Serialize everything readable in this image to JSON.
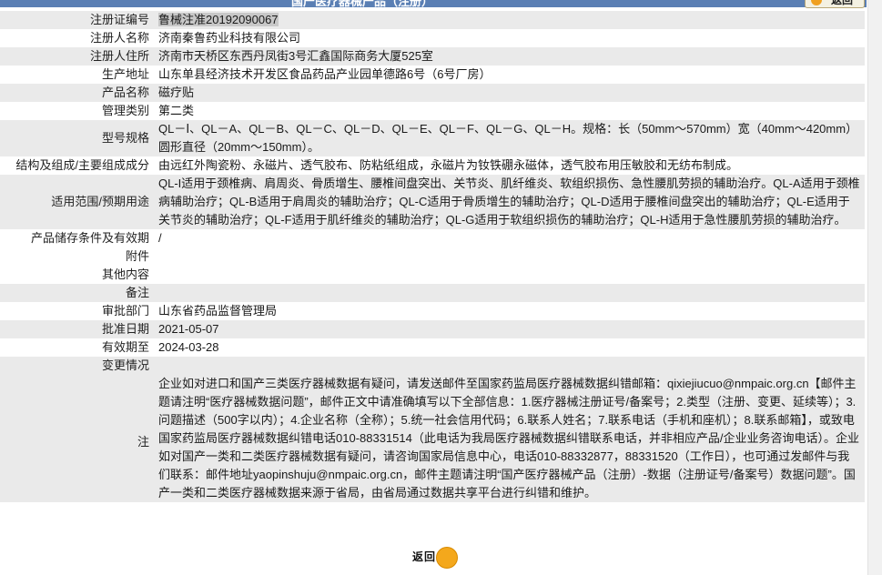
{
  "page": {
    "title": "国产医疗器械产品（注册）",
    "back_label": "返回"
  },
  "fields": [
    {
      "label": "注册证编号",
      "value": "鲁械注准20192090067"
    },
    {
      "label": "注册人名称",
      "value": "济南秦鲁药业科技有限公司"
    },
    {
      "label": "注册人住所",
      "value": "济南市天桥区东西丹凤街3号汇鑫国际商务大厦525室"
    },
    {
      "label": "生产地址",
      "value": "山东单县经济技术开发区食品药品产业园单德路6号（6号厂房）"
    },
    {
      "label": "产品名称",
      "value": "磁疗贴"
    },
    {
      "label": "管理类别",
      "value": "第二类"
    },
    {
      "label": "型号规格",
      "value": "QL－Ⅰ、QL－A、QL－B、QL－C、QL－D、QL－E、QL－F、QL－G、QL－H。规格：长（50mm～570mm）宽（40mm～420mm）圆形直径（20mm～150mm）。"
    },
    {
      "label": "结构及组成/主要组成成分",
      "value": "由远红外陶瓷粉、永磁片、透气胶布、防粘纸组成，永磁片为钕铁硼永磁体，透气胶布用压敏胶和无纺布制成。"
    },
    {
      "label": "适用范围/预期用途",
      "value": "QL-I适用于颈椎病、肩周炎、骨质增生、腰椎间盘突出、关节炎、肌纤维炎、软组织损伤、急性腰肌劳损的辅助治疗。QL-A适用于颈椎病辅助治疗；QL-B适用于肩周炎的辅助治疗；QL-C适用于骨质增生的辅助治疗；QL-D适用于腰椎间盘突出的辅助治疗；QL-E适用于关节炎的辅助治疗；QL-F适用于肌纤维炎的辅助治疗；QL-G适用于软组织损伤的辅助治疗；QL-H适用于急性腰肌劳损的辅助治疗。"
    },
    {
      "label": "产品储存条件及有效期",
      "value": "/"
    },
    {
      "label": "附件",
      "value": ""
    },
    {
      "label": "其他内容",
      "value": ""
    },
    {
      "label": "备注",
      "value": ""
    },
    {
      "label": "审批部门",
      "value": "山东省药品监督管理局"
    },
    {
      "label": "批准日期",
      "value": "2021-05-07"
    },
    {
      "label": "有效期至",
      "value": "2024-03-28"
    },
    {
      "label": "变更情况",
      "value": ""
    }
  ],
  "note": {
    "label": "注",
    "text": "企业如对进口和国产三类医疗器械数据有疑问，请发送邮件至国家药监局医疗器械数据纠错邮箱：qixiejiucuo@nmpaic.org.cn【邮件主题请注明“医疗器械数据问题”，邮件正文中请准确填写以下全部信息：1.医疗器械注册证号/备案号；2.类型（注册、变更、延续等）；3.问题描述（500字以内）；4.企业名称（全称）；5.统一社会信用代码；6.联系人姓名；7.联系电话（手机和座机）；8.联系邮箱】，或致电国家药监局医疗器械数据纠错电话010-88331514（此电话为我局医疗器械数据纠错联系电话，并非相应产品/企业业务咨询电话）。企业如对国产一类和二类医疗器械数据有疑问，请咨询国家局信息中心，电话010-88332877，88331520（工作日），也可通过发邮件与我们联系：邮件地址yaopinshuju@nmpaic.org.cn，邮件主题请注明“国产医疗器械产品（注册）-数据（注册证号/备案号）数据问题”。国产一类和二类医疗器械数据来源于省局，由省局通过数据共享平台进行纠错和维护。"
  }
}
